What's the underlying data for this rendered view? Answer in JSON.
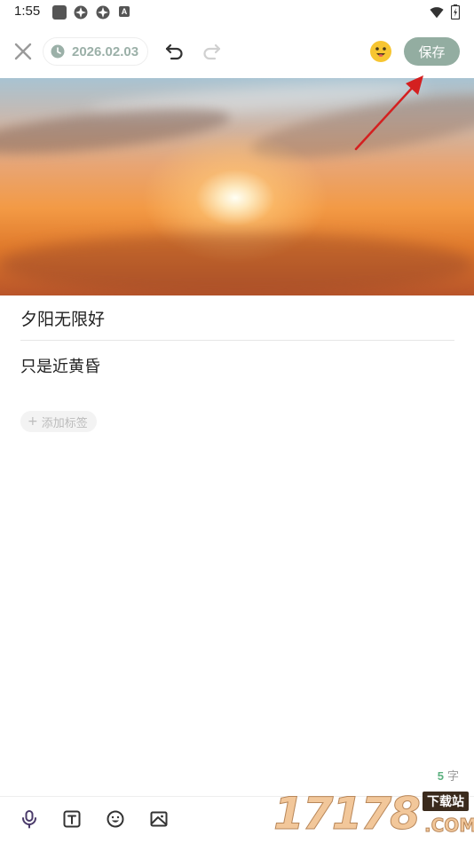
{
  "status_bar": {
    "time": "1:55"
  },
  "toolbar": {
    "date": "2026.02.03",
    "save_label": "保存"
  },
  "entry": {
    "title": "夕阳无限好",
    "body": "只是近黄昏",
    "add_tag_label": "添加标签"
  },
  "footer": {
    "word_count": "5",
    "word_unit": "字"
  },
  "watermark": {
    "numbers": "17178",
    "site_label": "下载站",
    "domain": ".COM"
  },
  "colors": {
    "save_button_bg": "#93ada1",
    "date_text": "#9bb0a8",
    "word_count_accent": "#5cb07f",
    "annotation_arrow": "#d42020"
  },
  "icons": {
    "close": "close-icon",
    "clock": "clock-icon",
    "undo": "undo-icon",
    "redo": "redo-icon",
    "mood": "mood-emoji-icon",
    "mic": "microphone-icon",
    "text_format": "text-format-icon",
    "emoji": "emoji-icon",
    "image": "image-icon"
  }
}
